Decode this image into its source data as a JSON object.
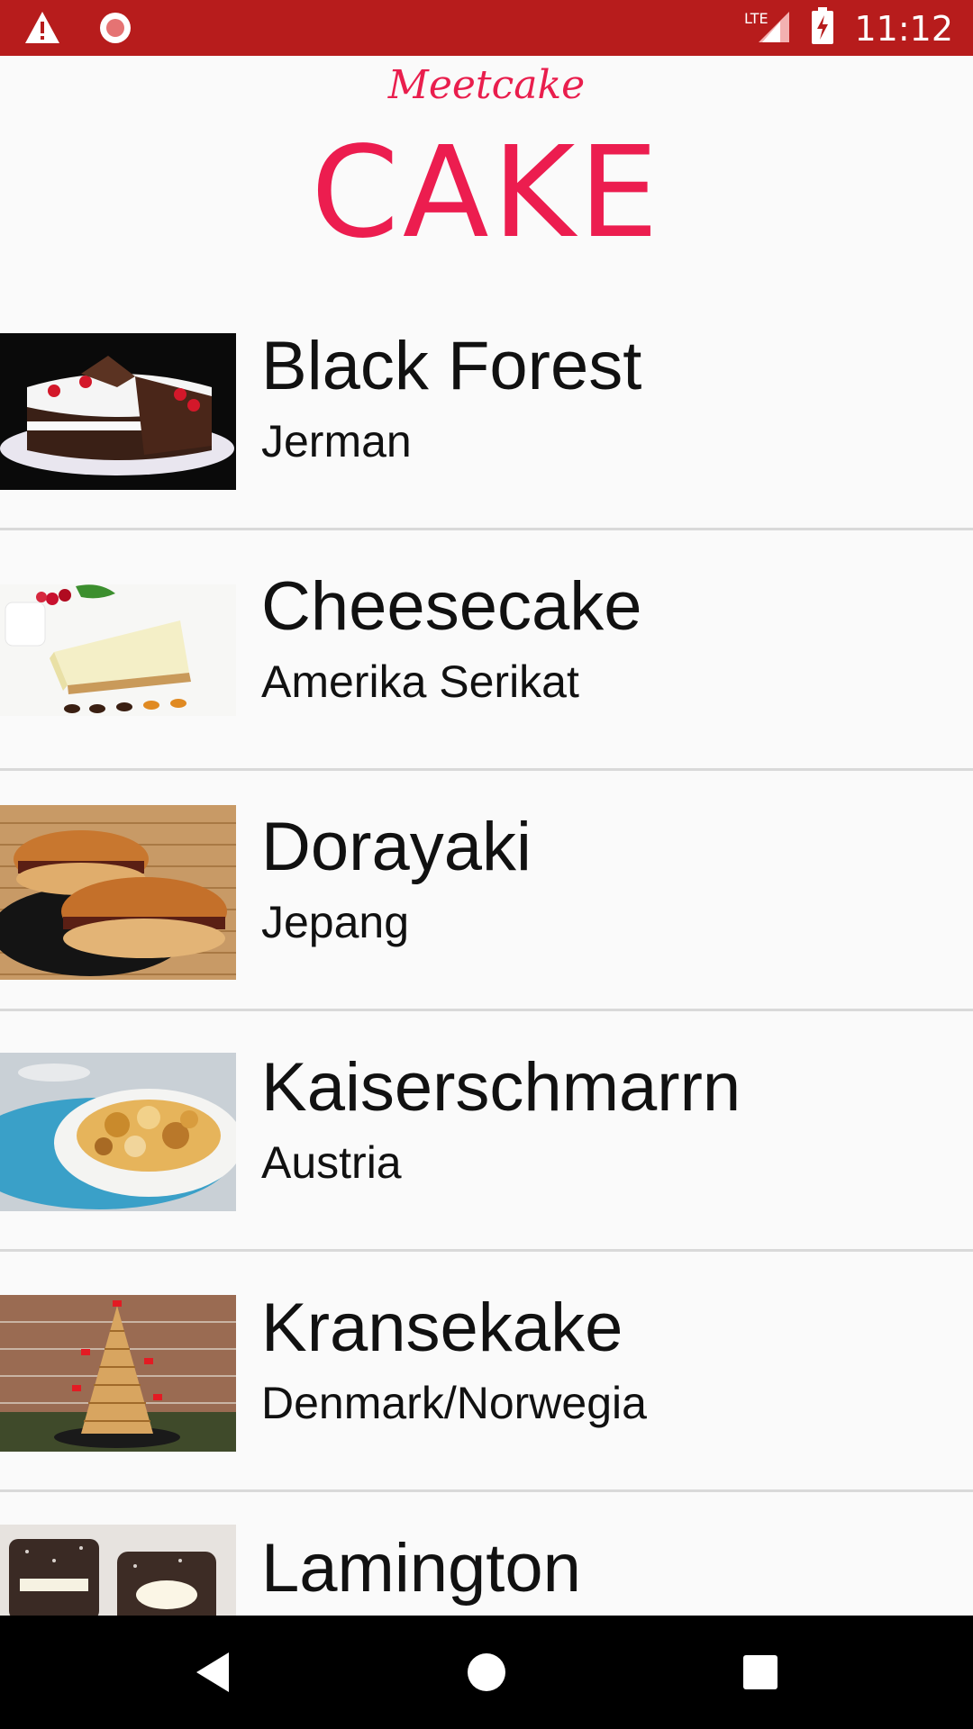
{
  "status_bar": {
    "time": "11:12",
    "network": "LTE",
    "icons": [
      "warning-icon",
      "record-icon",
      "signal-icon",
      "battery-charging-icon"
    ],
    "background": "#b71c1c"
  },
  "header": {
    "brand": "Meetcake",
    "title": "CAKE",
    "accent": "#ec1d4f"
  },
  "cakes": [
    {
      "name": "Black Forest",
      "origin": "Jerman"
    },
    {
      "name": "Cheesecake",
      "origin": "Amerika Serikat"
    },
    {
      "name": "Dorayaki",
      "origin": "Jepang"
    },
    {
      "name": "Kaiserschmarrn",
      "origin": "Austria"
    },
    {
      "name": "Kransekake",
      "origin": "Denmark/Norwegia"
    },
    {
      "name": "Lamington",
      "origin": ""
    }
  ],
  "nav_bar": {
    "icons": [
      "back-icon",
      "home-icon",
      "recents-icon"
    ]
  }
}
